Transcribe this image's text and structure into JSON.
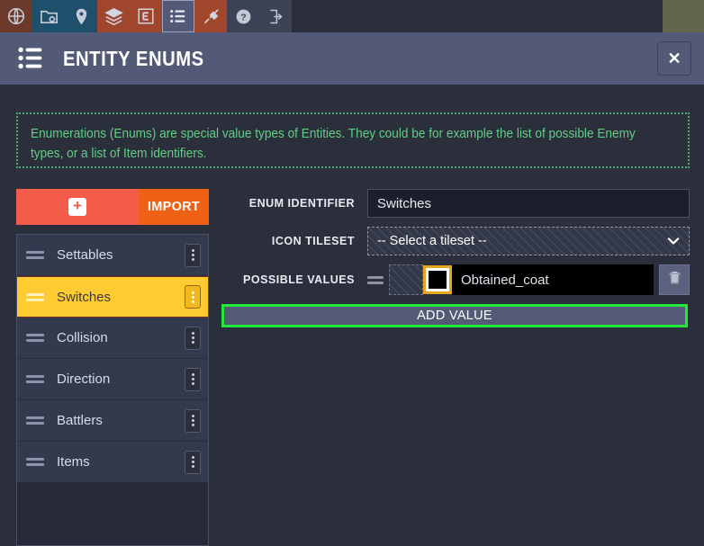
{
  "toolbar": {
    "buttons": [
      {
        "icon": "globe-icon",
        "group": "a"
      },
      {
        "icon": "folder-settings-icon",
        "group": "b"
      },
      {
        "icon": "map-pin-icon",
        "group": "b"
      },
      {
        "icon": "layers-icon",
        "group": "c"
      },
      {
        "icon": "entity-e-icon",
        "group": "c"
      },
      {
        "icon": "list-icon",
        "group": "active"
      },
      {
        "icon": "paint-brush-icon",
        "group": "c"
      },
      {
        "icon": "help-question-icon",
        "group": "d"
      },
      {
        "icon": "exit-arrow-icon",
        "group": "d"
      }
    ]
  },
  "header": {
    "title": "ENTITY ENUMS",
    "icon": "list-icon",
    "close_label": "✕"
  },
  "info": {
    "text": "Enumerations (Enums) are special value types of Entities. They could be for example the list of possible Enemy types, or a list of Item identifiers."
  },
  "left_panel": {
    "add_label": "+",
    "import_label": "IMPORT",
    "items": [
      {
        "label": "Settables",
        "selected": false
      },
      {
        "label": "Switches",
        "selected": true
      },
      {
        "label": "Collision",
        "selected": false
      },
      {
        "label": "Direction",
        "selected": false
      },
      {
        "label": "Battlers",
        "selected": false
      },
      {
        "label": "Items",
        "selected": false
      }
    ]
  },
  "form": {
    "enum_identifier_label": "ENUM IDENTIFIER",
    "enum_identifier_value": "Switches",
    "icon_tileset_label": "ICON TILESET",
    "icon_tileset_selected": "-- Select a tileset --",
    "icon_tileset_chevron": "⌄",
    "possible_values_label": "POSSIBLE VALUES",
    "values": [
      {
        "name": "Obtained_coat",
        "color": "#000000"
      }
    ],
    "add_value_label": "ADD VALUE",
    "delete_icon": "trash-icon"
  },
  "colors": {
    "background": "#2b2f3c",
    "header": "#525a77",
    "accent_red": "#f35b4a",
    "accent_orange": "#ef6216",
    "selected_yellow": "#fecb33",
    "info_green": "#5fcf83",
    "highlight_green": "#21e83b",
    "swatch_border": "#e8a520"
  }
}
